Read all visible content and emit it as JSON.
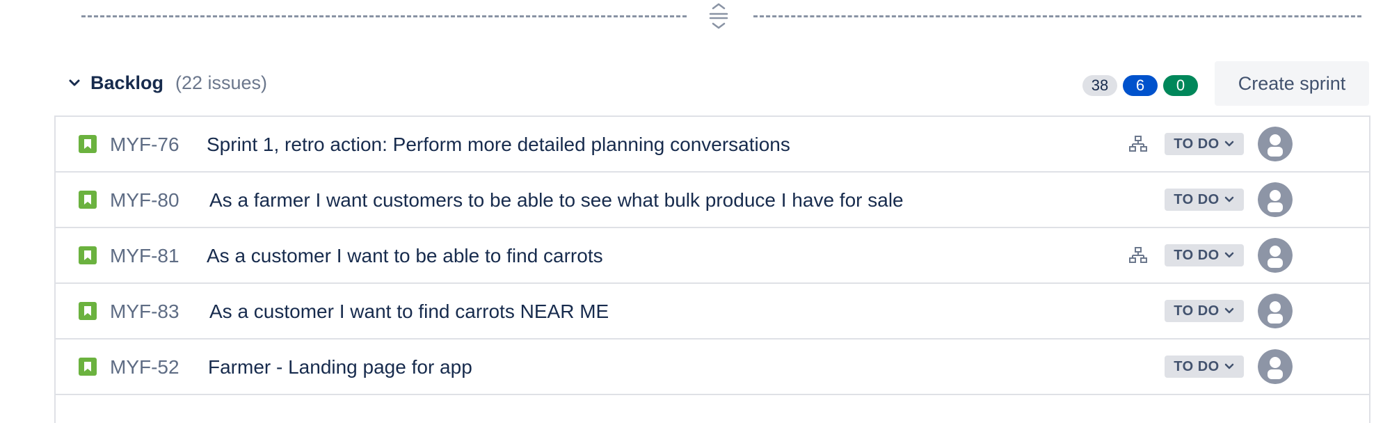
{
  "divider": {
    "icon": "drag-handle-icon"
  },
  "backlog": {
    "title": "Backlog",
    "count_label": "(22 issues)",
    "collapse_icon": "chevron-down-icon",
    "counters": {
      "todo": "38",
      "in_progress": "6",
      "done": "0"
    },
    "create_sprint_label": "Create sprint"
  },
  "colors": {
    "story": "#6bb23f",
    "todo_counter": "#dfe1e6",
    "in_progress_counter": "#0052cc",
    "done_counter": "#00875a",
    "lozenge": "#dfe1e6",
    "avatar": "#8d95a6"
  },
  "issues": [
    {
      "key": "MYF-76",
      "summary": "Sprint 1, retro action: Perform more detailed planning conversations",
      "status": "TO DO",
      "type_icon": "story-icon",
      "has_child_issues": true
    },
    {
      "key": "MYF-80",
      "summary": "As a farmer I want customers to be able to see what bulk produce I have for sale",
      "status": "TO DO",
      "type_icon": "story-icon",
      "has_child_issues": false
    },
    {
      "key": "MYF-81",
      "summary": "As a customer I want to be able to find carrots",
      "status": "TO DO",
      "type_icon": "story-icon",
      "has_child_issues": true
    },
    {
      "key": "MYF-83",
      "summary": "As a customer I want to find carrots NEAR ME",
      "status": "TO DO",
      "type_icon": "story-icon",
      "has_child_issues": false
    },
    {
      "key": "MYF-52",
      "summary": "Farmer - Landing page for app",
      "status": "TO DO",
      "type_icon": "story-icon",
      "has_child_issues": false
    }
  ]
}
